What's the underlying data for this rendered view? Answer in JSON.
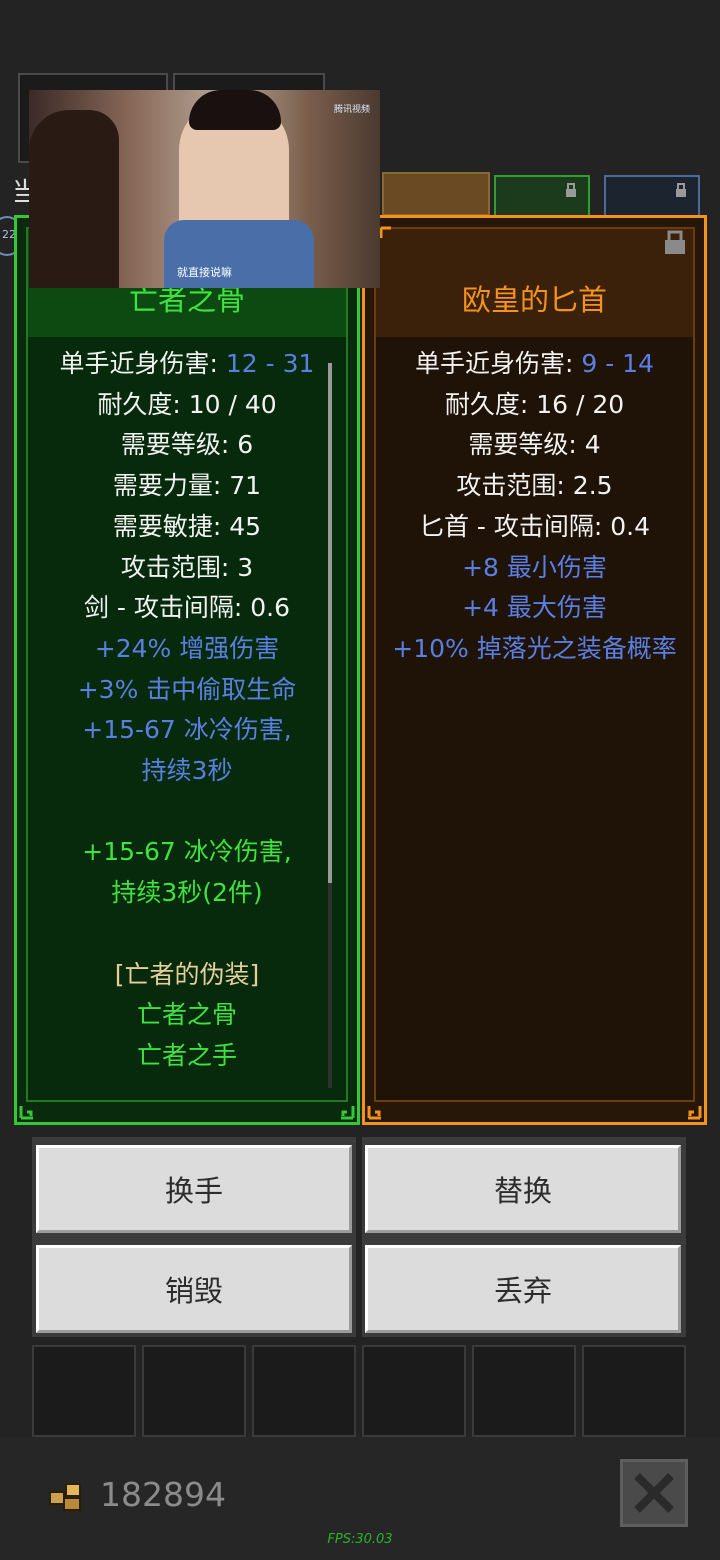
{
  "left_item": {
    "title": "亡者之骨",
    "stats": [
      {
        "label": "单手近身伤害: ",
        "value": "12 - 31"
      },
      {
        "text": "耐久度: 10 / 40"
      },
      {
        "text": "需要等级: 6"
      },
      {
        "text": "需要力量: 71"
      },
      {
        "text": "需要敏捷: 45"
      },
      {
        "text": "攻击范围: 3"
      },
      {
        "text": "剑 - 攻击间隔: 0.6"
      }
    ],
    "affixes": [
      "+24% 增强伤害",
      "+3% 击中偷取生命",
      "+15-67 冰冷伤害,",
      "持续3秒"
    ],
    "set_bonus": [
      "+15-67 冰冷伤害,",
      "持续3秒(2件)"
    ],
    "set_name": "[亡者的伪装]",
    "set_items": [
      "亡者之骨",
      "亡者之手"
    ]
  },
  "right_item": {
    "title": "欧皇的匕首",
    "stats": [
      {
        "label": "单手近身伤害: ",
        "value": "9 - 14"
      },
      {
        "text": "耐久度: 16 / 20"
      },
      {
        "text": "需要等级: 4"
      },
      {
        "text": "攻击范围: 2.5"
      },
      {
        "text": "匕首 - 攻击间隔: 0.4"
      }
    ],
    "affixes": [
      "+8 最小伤害",
      "+4 最大伤害",
      "+10% 掉落光之装备概率"
    ]
  },
  "buttons": {
    "swap_hand": "换手",
    "replace": "替换",
    "destroy": "销毁",
    "discard": "丢弃"
  },
  "currency": {
    "icon": "gold-ore-icon",
    "amount": "182894"
  },
  "fps": "FPS:30.03",
  "video": {
    "subtitle": "就直接说嘛",
    "logo": "腾讯视频"
  },
  "partial_text": {
    "side_char": "当",
    "badge": "22"
  },
  "colors": {
    "set_green": "#35c735",
    "unique_orange": "#f4921e",
    "affix_blue": "#5a7fe0",
    "set_text_green": "#3fe23f"
  }
}
